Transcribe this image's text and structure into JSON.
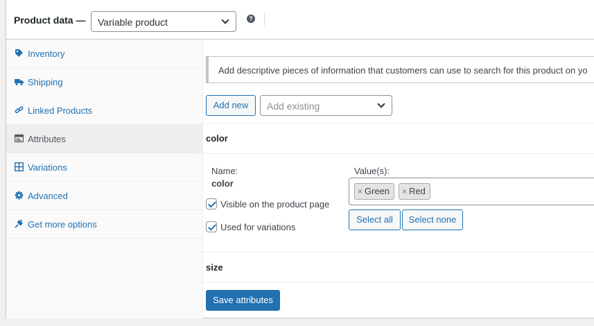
{
  "header": {
    "title": "Product data —",
    "product_type": "Variable product",
    "help_glyph": "?"
  },
  "tabs": [
    {
      "label": "Inventory",
      "icon": "inventory-icon"
    },
    {
      "label": "Shipping",
      "icon": "truck-icon"
    },
    {
      "label": "Linked Products",
      "icon": "link-icon"
    },
    {
      "label": "Attributes",
      "icon": "attributes-icon",
      "active": true
    },
    {
      "label": "Variations",
      "icon": "grid-icon"
    },
    {
      "label": "Advanced",
      "icon": "gear-icon"
    },
    {
      "label": "Get more options",
      "icon": "plugin-icon"
    }
  ],
  "notice": "Add descriptive pieces of information that customers can use to search for this product on yo",
  "toolbar": {
    "add_new_label": "Add new",
    "add_existing_placeholder": "Add existing"
  },
  "attributes": [
    {
      "name": "color",
      "name_label": "Name:",
      "name_value": "color",
      "values_label": "Value(s):",
      "values": [
        "Green",
        "Red"
      ],
      "visible_label": "Visible on the product page",
      "visible_checked": true,
      "variations_label": "Used for variations",
      "variations_checked": true,
      "select_all_label": "Select all",
      "select_none_label": "Select none",
      "remove_glyph": "×"
    },
    {
      "name": "size"
    }
  ],
  "save_label": "Save attributes",
  "colors": {
    "primary": "#2271b1",
    "border": "#c3c4c7",
    "sidebar_bg": "#fafafa",
    "active_tab_bg": "#eeeeee"
  }
}
